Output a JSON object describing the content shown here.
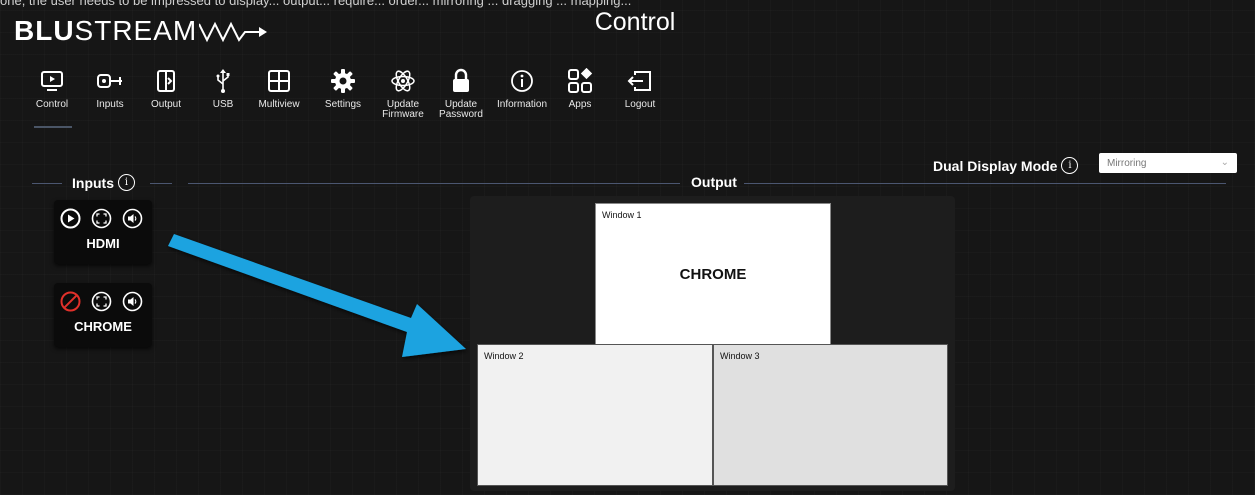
{
  "top_caption": "one, the user needs to be impressed to display... output... require... order... mirroring ... dragging ... mapping...",
  "brand": {
    "bold": "BLU",
    "light": "STREAM"
  },
  "page_title": "Control",
  "nav": [
    {
      "label": "Control",
      "icon": "tv-play-icon"
    },
    {
      "label": "Inputs",
      "icon": "input-cable-icon"
    },
    {
      "label": "Output",
      "icon": "output-icon"
    },
    {
      "label": "USB",
      "icon": "usb-icon"
    },
    {
      "label": "Multiview",
      "icon": "multiview-grid-icon"
    },
    {
      "label": "Settings",
      "icon": "gear-icon"
    },
    {
      "label": "Update\nFirmware",
      "icon": "atom-icon"
    },
    {
      "label": "Update\nPassword",
      "icon": "lock-icon"
    },
    {
      "label": "Information",
      "icon": "info-icon"
    },
    {
      "label": "Apps",
      "icon": "apps-icon"
    },
    {
      "label": "Logout",
      "icon": "logout-icon"
    }
  ],
  "sections": {
    "inputs": "Inputs",
    "output": "Output"
  },
  "dual_display": {
    "label": "Dual Display Mode",
    "value": "Mirroring"
  },
  "inputs": [
    {
      "name": "HDMI",
      "state": "playing"
    },
    {
      "name": "CHROME",
      "state": "disabled"
    }
  ],
  "windows": [
    {
      "title": "Window 1",
      "source": "CHROME"
    },
    {
      "title": "Window 2",
      "source": ""
    },
    {
      "title": "Window 3",
      "source": ""
    }
  ],
  "colors": {
    "background": "#161616",
    "accent_arrow": "#1aa3e0",
    "disabled_red": "#e0302a"
  }
}
